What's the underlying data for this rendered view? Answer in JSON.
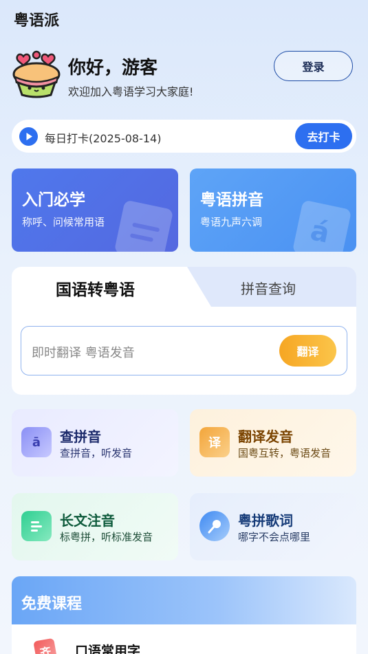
{
  "app": {
    "title": "粤语派"
  },
  "profile": {
    "greeting": "你好，游客",
    "welcome": "欢迎加入粤语学习大家庭!",
    "login_label": "登录"
  },
  "checkin": {
    "text": "每日打卡(2025-08-14)",
    "button_label": "去打卡"
  },
  "feature_cards": [
    {
      "title": "入门必学",
      "subtitle": "称呼、问候常用语"
    },
    {
      "title": "粤语拼音",
      "subtitle": "粤语九声六调",
      "deco_char": "á"
    }
  ],
  "translator": {
    "tabs": [
      "国语转粤语",
      "拼音查询"
    ],
    "active_tab": 0,
    "placeholder": "即时翻译 粤语发音",
    "button_label": "翻译"
  },
  "tools": [
    {
      "title": "查拼音",
      "subtitle": "查拼音，听发音",
      "icon_char": "ā",
      "title_color": "#1c2a6b",
      "sub_color": "#2a3570"
    },
    {
      "title": "翻译发音",
      "subtitle": "国粤互转，粤语发音",
      "icon_char": "译",
      "title_color": "#7a4300",
      "sub_color": "#6b4a15"
    },
    {
      "title": "长文注音",
      "subtitle": "标粤拼，听标准发音",
      "icon_char": "",
      "title_color": "#0d5a3b",
      "sub_color": "#1d4d37"
    },
    {
      "title": "粤拼歌词",
      "subtitle": "哪字不会点哪里",
      "icon_char": "",
      "title_color": "#163b78",
      "sub_color": "#2a3e66"
    }
  ],
  "courses": {
    "header": "免费课程",
    "items": [
      {
        "title": "口语常用字",
        "icon_char": "齐"
      }
    ]
  },
  "colors": {
    "primary": "#2d6ff0",
    "accent_orange": "#f6a623"
  }
}
